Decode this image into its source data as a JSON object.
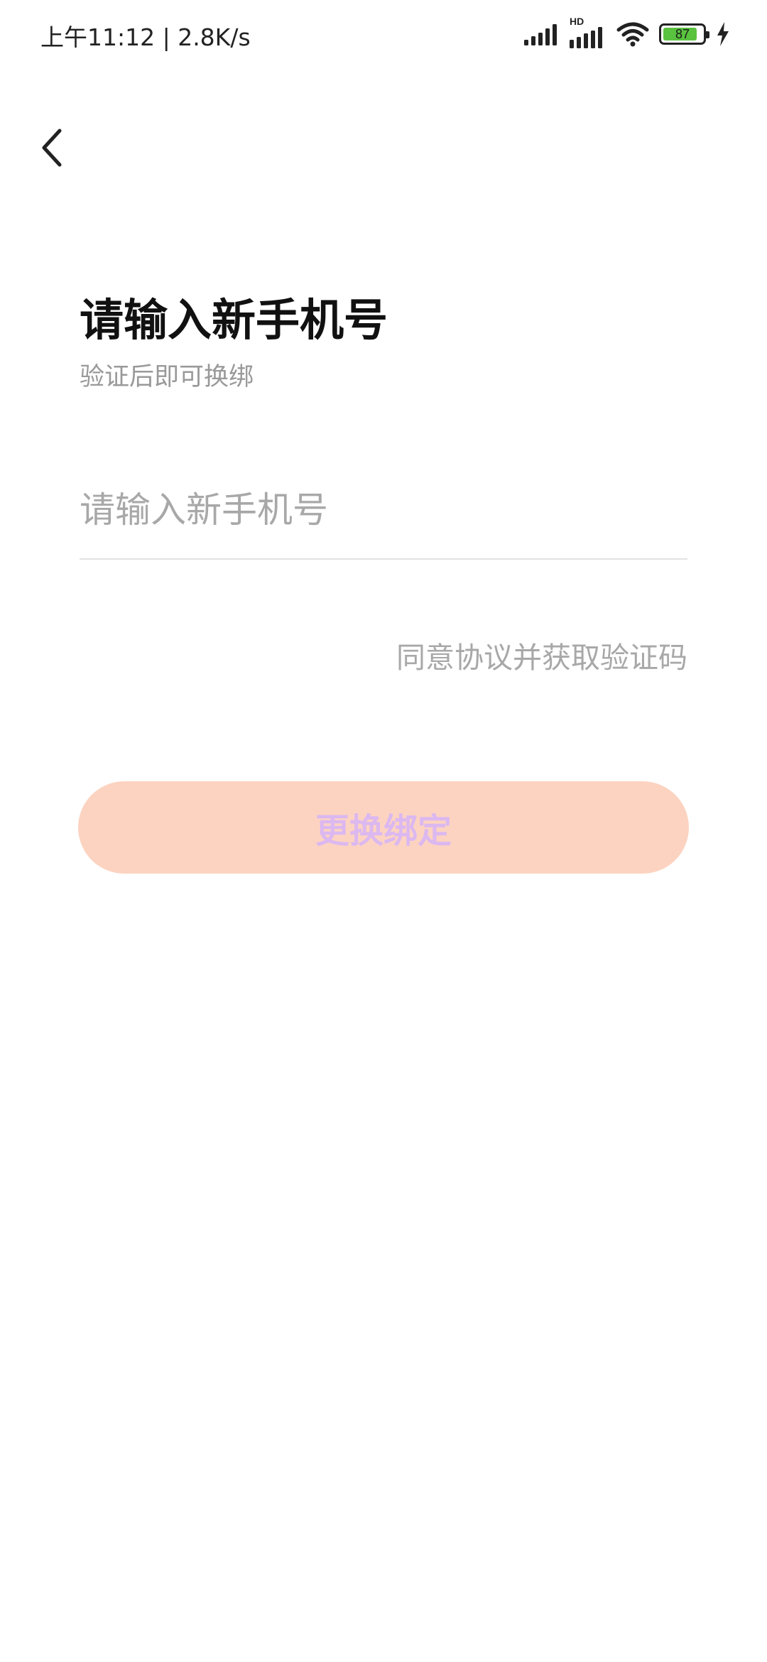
{
  "status_bar": {
    "time_speed": "上午11:12 | 2.8K/s",
    "network_label": "HD",
    "battery_level": "87",
    "battery_fraction": 0.87,
    "battery_color": "#59c23f"
  },
  "header": {
    "back_icon": "chevron-left-icon"
  },
  "content": {
    "title": "请输入新手机号",
    "subtitle": "验证后即可换绑",
    "phone_input": {
      "placeholder": "请输入新手机号",
      "value": ""
    },
    "get_code_label": "同意协议并获取验证码"
  },
  "primary_button": {
    "label": "更换绑定",
    "background": "#fcd3c1",
    "text_color": "#dcb8f0"
  }
}
